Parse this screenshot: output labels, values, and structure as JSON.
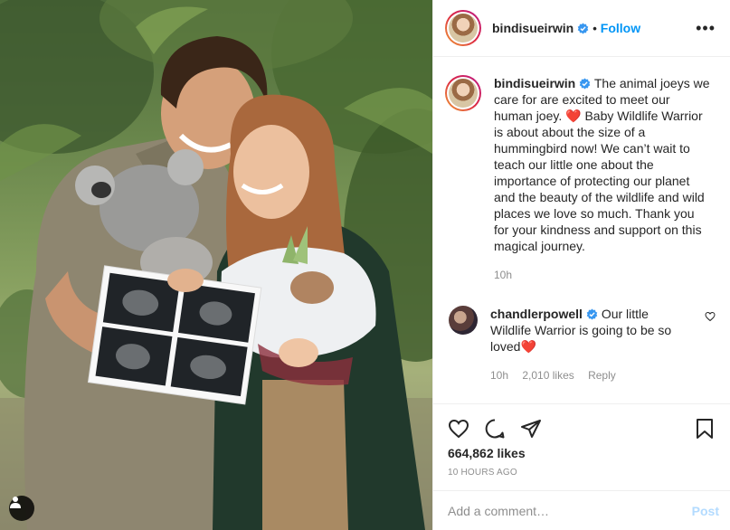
{
  "post": {
    "author": {
      "username": "bindisueirwin",
      "verified": true,
      "follow_label": "Follow",
      "separator": "•"
    },
    "more_label": "•••",
    "caption": {
      "username": "bindisueirwin",
      "text_part1": "The animal joeys we care for are excited to meet our human joey.",
      "heart": "❤️",
      "text_part2": "Baby Wildlife Warrior is about about the size of a hummingbird now! We can’t wait to teach our little one about the importance of protecting our planet and the beauty of the wildlife and wild places we love so much. Thank you for your kindness and support on this magical journey.",
      "age": "10h"
    },
    "comments": [
      {
        "username": "chandlerpowell",
        "verified": true,
        "text": "Our little Wildlife Warrior is going to be so loved",
        "heart": "❤️",
        "age": "10h",
        "likes": "2,010 likes",
        "reply_label": "Reply"
      }
    ],
    "likes_count": "664,862 likes",
    "timestamp": "10 HOURS AGO",
    "add_comment_placeholder": "Add a comment…",
    "post_button": "Post"
  },
  "icons": {
    "verified": "verified-badge-icon",
    "like": "heart-outline-icon",
    "comment": "speech-bubble-icon",
    "share": "paper-plane-icon",
    "save": "bookmark-icon",
    "user_tag": "user-tag-icon",
    "comment_like": "small-heart-icon"
  },
  "colors": {
    "accent": "#0095f6",
    "text": "#262626",
    "muted": "#8e8e8e",
    "border": "#efefef",
    "post_disabled": "#b3dbff",
    "heart": "#e0142d"
  }
}
